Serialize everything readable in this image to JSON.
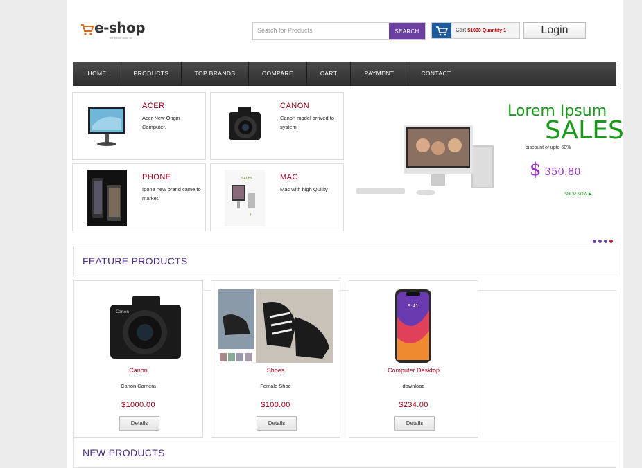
{
  "header": {
    "logo_text": "e-shop",
    "logo_tagline": "the ipsum dolor sit",
    "search_placeholder": "Search for Products",
    "search_button": "SEARCH",
    "cart_label": "Cart",
    "cart_amount": "$1000 Quantity 1",
    "login_label": "Login"
  },
  "nav": {
    "items": [
      {
        "label": "HOME"
      },
      {
        "label": "PRODUCTS"
      },
      {
        "label": "TOP BRANDS"
      },
      {
        "label": "COMPARE"
      },
      {
        "label": "CART"
      },
      {
        "label": "PAYMENT"
      },
      {
        "label": "CONTACT"
      }
    ]
  },
  "categories": [
    {
      "name": "ACER",
      "desc": "Acer New Origin Computer."
    },
    {
      "name": "CANON",
      "desc": "Canon model arrived to system."
    },
    {
      "name": "PHONE",
      "desc": "Ipone new brand came to market."
    },
    {
      "name": "MAC",
      "desc": "Mac with high Quility"
    }
  ],
  "banner": {
    "heading": "Lorem Ipsum",
    "sales": "SALES",
    "discount": "discount of upto 60%",
    "price_symbol": "$",
    "price": "350.80",
    "shop_now": "SHOP NOW ▶"
  },
  "sections": {
    "feature_title": "FEATURE PRODUCTS",
    "new_title": "NEW PRODUCTS"
  },
  "products": [
    {
      "name": "Canon",
      "desc": "Canon Camera",
      "price": "$1000.00",
      "button": "Details"
    },
    {
      "name": "Shoes",
      "desc": "Female Shoe",
      "price": "$100.00",
      "button": "Details"
    },
    {
      "name": "Computer Desktop",
      "desc": "download",
      "price": "$234.00",
      "button": "Details"
    }
  ],
  "colors": {
    "accent": "#6b3fa0",
    "brand_red": "#a0001a",
    "nav_bg": "#3a3a3a",
    "banner_green": "#1a9a1a"
  }
}
